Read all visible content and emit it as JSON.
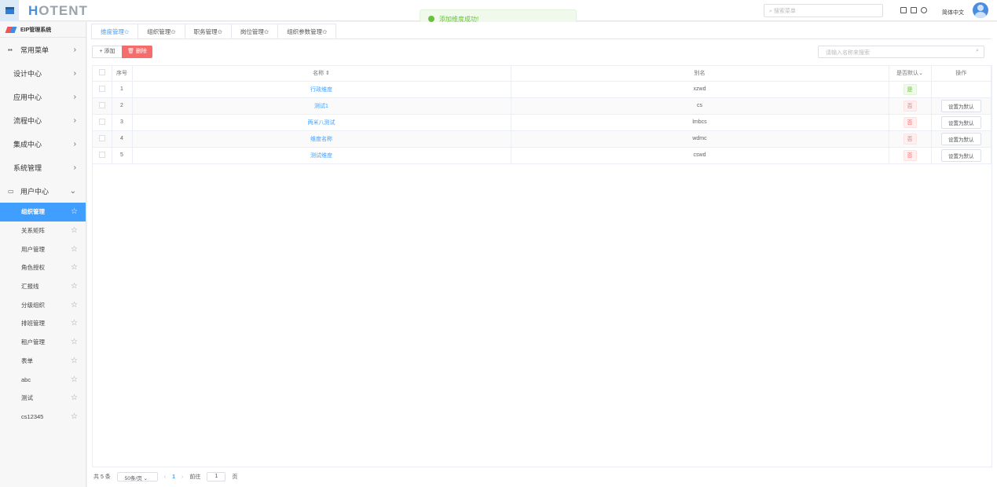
{
  "header": {
    "logo": "HOTENT",
    "search_placeholder": "搜索菜单",
    "language": "简体中文"
  },
  "toast": {
    "message": "添加维度成功!"
  },
  "sidebar": {
    "brand": "EIP管理系统",
    "menus": [
      {
        "label": "常用菜单"
      },
      {
        "label": "设计中心"
      },
      {
        "label": "应用中心"
      },
      {
        "label": "流程中心"
      },
      {
        "label": "集成中心"
      },
      {
        "label": "系统管理"
      },
      {
        "label": "用户中心"
      }
    ],
    "subitems": [
      {
        "label": "组织管理"
      },
      {
        "label": "关系矩阵"
      },
      {
        "label": "用户管理"
      },
      {
        "label": "角色授权"
      },
      {
        "label": "汇报线"
      },
      {
        "label": "分级组织"
      },
      {
        "label": "排班管理"
      },
      {
        "label": "租户管理"
      },
      {
        "label": "表单"
      },
      {
        "label": "abc"
      },
      {
        "label": "测试"
      },
      {
        "label": "cs12345"
      }
    ]
  },
  "tabs": [
    {
      "label": "维度管理✩"
    },
    {
      "label": "组织管理✩"
    },
    {
      "label": "职务管理✩"
    },
    {
      "label": "岗位管理✩"
    },
    {
      "label": "组织参数管理✩"
    }
  ],
  "toolbar": {
    "add": "添加",
    "delete": "删除",
    "search_placeholder": "请输入名称来搜索"
  },
  "table": {
    "headers": {
      "index": "序号",
      "name": "名称",
      "alias": "别名",
      "default": "是否默认",
      "action": "操作"
    },
    "rows": [
      {
        "index": "1",
        "name": "行政维度",
        "alias": "xzwd",
        "default": "是",
        "action": ""
      },
      {
        "index": "2",
        "name": "测试1",
        "alias": "cs",
        "default": "否",
        "action": "设置为默认"
      },
      {
        "index": "3",
        "name": "两米八测试",
        "alias": "lmbcs",
        "default": "否",
        "action": "设置为默认"
      },
      {
        "index": "4",
        "name": "维度名称",
        "alias": "wdmc",
        "default": "否",
        "action": "设置为默认"
      },
      {
        "index": "5",
        "name": "测试维度",
        "alias": "cswd",
        "default": "否",
        "action": "设置为默认"
      }
    ]
  },
  "pagination": {
    "total": "共 5 条",
    "page_size": "50条/页",
    "current": "1",
    "goto_label": "前往",
    "goto_value": "1",
    "page_suffix": "页"
  }
}
